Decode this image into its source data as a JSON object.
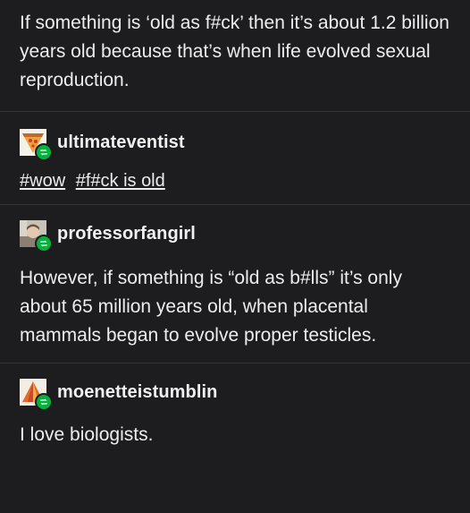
{
  "intro_post": {
    "text": "If something is ‘old as f#ck’ then it’s about 1.2 billion years old because that’s when life evolved sexual reproduction."
  },
  "reblogs": [
    {
      "username": "ultimateventist",
      "avatar_icon": "pizza-slice-icon",
      "tags": [
        "#wow",
        "#f#ck is old"
      ]
    },
    {
      "username": "professorfangirl",
      "avatar_icon": "photo-avatar",
      "text": "However, if something is “old as b#lls” it’s only about 65 million years old, when placental mammals began to evolve proper testicles."
    },
    {
      "username": "moenetteistumblin",
      "avatar_icon": "triangle-logo-icon",
      "text": "I love biologists."
    }
  ],
  "colors": {
    "background": "#1d1d1f",
    "text": "#ededed",
    "divider": "#343436",
    "reblog_badge": "#00b33c"
  }
}
